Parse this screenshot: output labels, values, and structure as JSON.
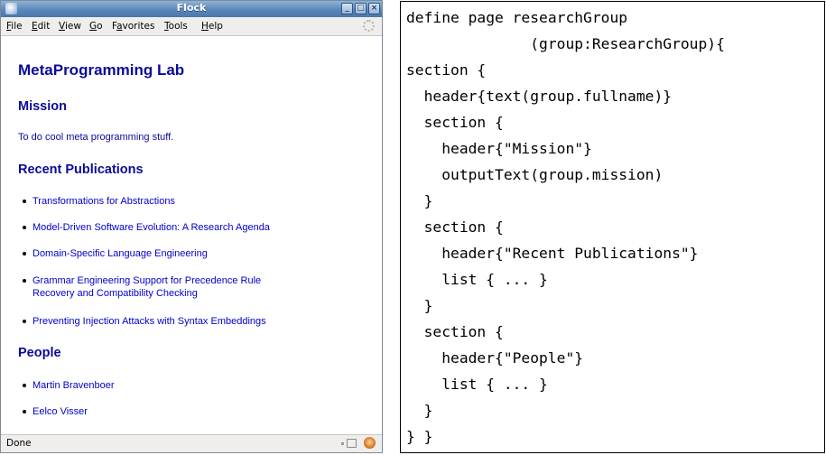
{
  "window": {
    "title": "Flock",
    "menu": [
      {
        "pre": "",
        "u": "F",
        "post": "ile"
      },
      {
        "pre": "",
        "u": "E",
        "post": "dit"
      },
      {
        "pre": "",
        "u": "V",
        "post": "iew"
      },
      {
        "pre": "",
        "u": "G",
        "post": "o"
      },
      {
        "pre": "F",
        "u": "a",
        "post": "vorites"
      },
      {
        "pre": "",
        "u": "T",
        "post": "ools"
      },
      {
        "pre": "",
        "u": "H",
        "post": "elp"
      }
    ],
    "status": "Done"
  },
  "page": {
    "title": "MetaProgramming Lab",
    "mission_header": "Mission",
    "mission_text": "To do cool meta programming stuff.",
    "publications_header": "Recent Publications",
    "publications": [
      {
        "line1": "Transformations for Abstractions",
        "line2": ""
      },
      {
        "line1": "Model-Driven Software Evolution: A Research Agenda",
        "line2": ""
      },
      {
        "line1": "Domain-Specific Language Engineering",
        "line2": ""
      },
      {
        "line1": "Grammar Engineering Support for Precedence Rule",
        "line2": "Recovery and Compatibility Checking"
      },
      {
        "line1": "Preventing Injection Attacks with Syntax Embeddings",
        "line2": ""
      }
    ],
    "people_header": "People",
    "people": [
      "Martin Bravenboer",
      "Eelco Visser"
    ]
  },
  "code": [
    "define page researchGroup",
    "              (group:ResearchGroup){",
    "section {",
    "  header{text(group.fullname)}",
    "  section {",
    "    header{\"Mission\"}",
    "    outputText(group.mission)",
    "  }",
    "  section {",
    "    header{\"Recent Publications\"}",
    "    list { ... }",
    "  }",
    "  section {",
    "    header{\"People\"}",
    "    list { ... }",
    "  }",
    "} }"
  ],
  "colors": {
    "heading": "#0a0a9a",
    "link": "#0000cc",
    "titlebar": "#5b86b8"
  }
}
